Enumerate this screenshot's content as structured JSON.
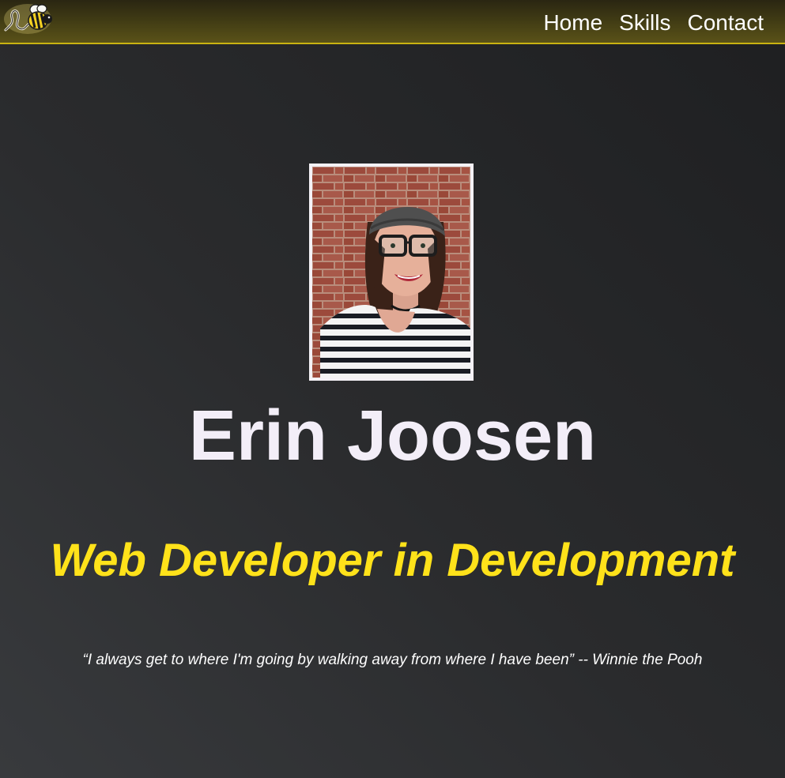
{
  "nav": {
    "logo_icon": "bee-logo-icon",
    "links": [
      {
        "label": "Home"
      },
      {
        "label": "Skills"
      },
      {
        "label": "Contact"
      }
    ],
    "accent_color": "#c9b311"
  },
  "hero": {
    "portrait_icon": "profile-photo",
    "name": "Erin Joosen",
    "tagline": "Web Developer in Development",
    "tagline_color": "#ffe21a",
    "quote": "“I always get to where I'm going by walking away from where I have been” -- Winnie the Pooh"
  }
}
